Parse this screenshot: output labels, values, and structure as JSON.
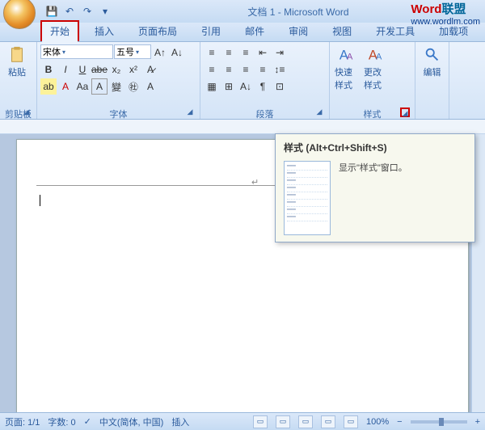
{
  "title": "文档 1 - Microsoft Word",
  "watermark": {
    "part1": "Word",
    "part2": "联盟",
    "url": "www.wordlm.com"
  },
  "tabs": [
    "开始",
    "插入",
    "页面布局",
    "引用",
    "邮件",
    "审阅",
    "视图",
    "开发工具",
    "加载项"
  ],
  "active_tab": 0,
  "clipboard": {
    "paste": "粘贴",
    "label": "剪贴板"
  },
  "font": {
    "name": "宋体",
    "size": "五号",
    "label": "字体"
  },
  "paragraph": {
    "label": "段落"
  },
  "styles": {
    "quick": "快速样式",
    "change": "更改样式",
    "label": "样式"
  },
  "editing": {
    "label": "编辑"
  },
  "tooltip": {
    "title": "样式 (Alt+Ctrl+Shift+S)",
    "text": "显示\"样式\"窗口。"
  },
  "status": {
    "page": "页面: 1/1",
    "words": "字数: 0",
    "lang": "中文(简体, 中国)",
    "mode": "插入",
    "zoom": "100%"
  }
}
